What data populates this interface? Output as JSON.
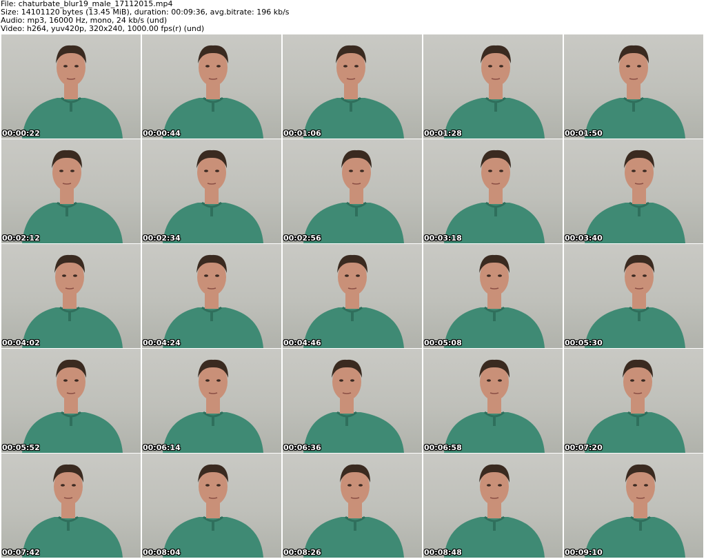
{
  "header": {
    "file": "File: chaturbate_blur19_male_17112015.mp4",
    "size": "Size: 14101120 bytes (13.45 MiB), duration: 00:09:36, avg.bitrate: 196 kb/s",
    "audio": "Audio: mp3, 16000 Hz, mono, 24 kb/s (und)",
    "video": "Video: h264, yuv420p, 320x240, 1000.00 fps(r) (und)"
  },
  "thumbnails": [
    {
      "time": "00:00:22"
    },
    {
      "time": "00:00:44"
    },
    {
      "time": "00:01:06"
    },
    {
      "time": "00:01:28"
    },
    {
      "time": "00:01:50"
    },
    {
      "time": "00:02:12"
    },
    {
      "time": "00:02:34"
    },
    {
      "time": "00:02:56"
    },
    {
      "time": "00:03:18"
    },
    {
      "time": "00:03:40"
    },
    {
      "time": "00:04:02"
    },
    {
      "time": "00:04:24"
    },
    {
      "time": "00:04:46"
    },
    {
      "time": "00:05:08"
    },
    {
      "time": "00:05:30"
    },
    {
      "time": "00:05:52"
    },
    {
      "time": "00:06:14"
    },
    {
      "time": "00:06:36"
    },
    {
      "time": "00:06:58"
    },
    {
      "time": "00:07:20"
    },
    {
      "time": "00:07:42"
    },
    {
      "time": "00:08:04"
    },
    {
      "time": "00:08:26"
    },
    {
      "time": "00:08:48"
    },
    {
      "time": "00:09:10"
    }
  ],
  "colors": {
    "background_wall": "#c2c3bd",
    "shirt": "#3f8a74",
    "skin": "#c99078",
    "hair": "#3a2a20",
    "timestamp_text": "#ffffff"
  }
}
